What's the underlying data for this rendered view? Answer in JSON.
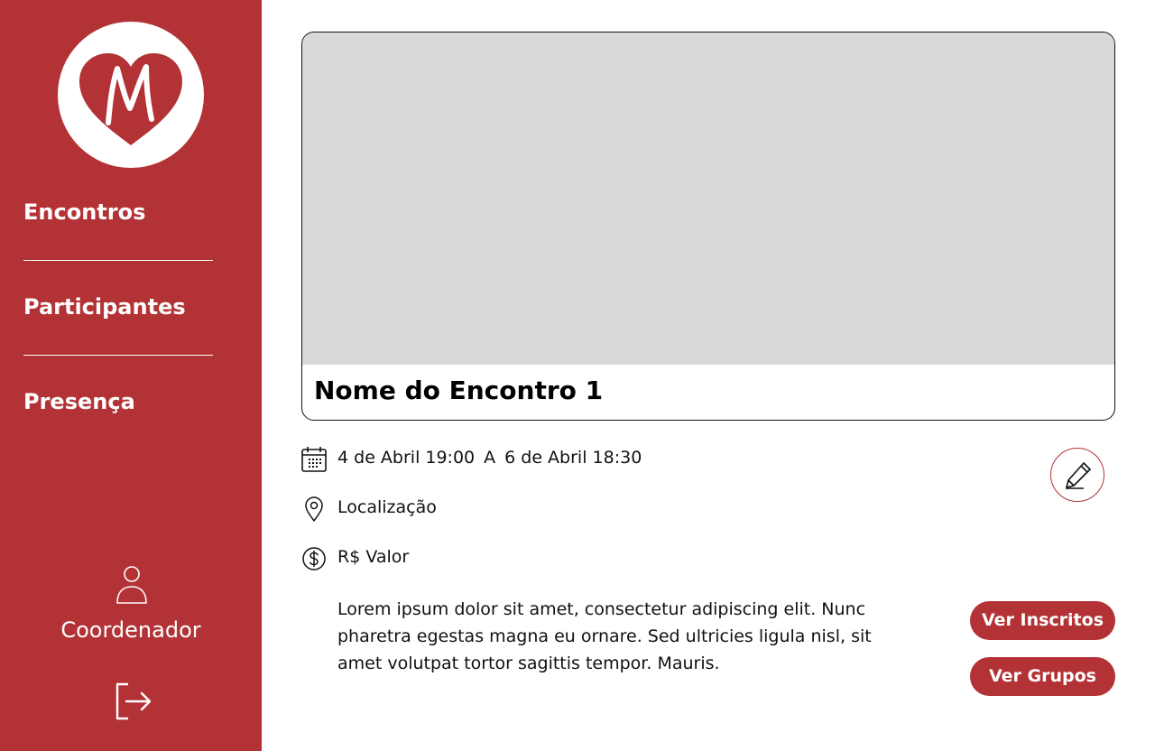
{
  "brand": {
    "accent": "#b33235",
    "logo_icon": "heart-m-logo"
  },
  "sidebar": {
    "items": [
      {
        "label": "Encontros",
        "name": "sidebar-item-encontros"
      },
      {
        "label": "Participantes",
        "name": "sidebar-item-participantes"
      },
      {
        "label": "Presença",
        "name": "sidebar-item-presenca"
      }
    ],
    "user": {
      "label": "Coordenador",
      "icon": "user-icon"
    },
    "logout_icon": "logout-icon"
  },
  "event": {
    "title": "Nome do Encontro 1",
    "date_start": "4 de Abril 19:00",
    "date_separator": "A",
    "date_end": "6 de Abril 18:30",
    "location": "Localização",
    "price": "R$ Valor",
    "description": "Lorem ipsum dolor sit amet, consectetur adipiscing elit. Nunc pharetra egestas magna eu ornare. Sed ultricies ligula nisl, sit amet volutpat tortor sagittis tempor. Mauris."
  },
  "actions": {
    "edit_icon": "pencil-icon",
    "ver_inscritos": "Ver Inscritos",
    "ver_grupos": "Ver Grupos"
  }
}
